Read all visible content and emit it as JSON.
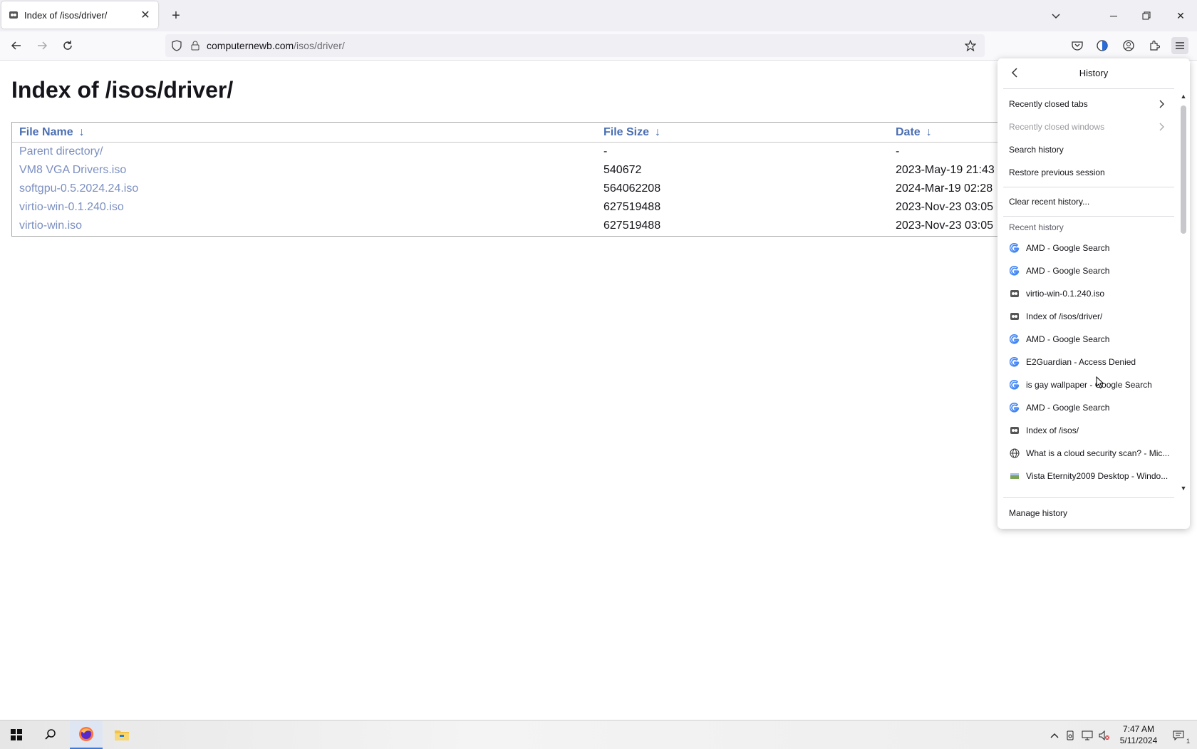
{
  "browser": {
    "tab_title": "Index of /isos/driver/",
    "url_host": "computernewb.com",
    "url_path": "/isos/driver/"
  },
  "page": {
    "title": "Index of /isos/driver/",
    "columns": {
      "name": "File Name",
      "size": "File Size",
      "date": "Date",
      "sort_arrow": "↓"
    },
    "rows": [
      {
        "name": "Parent directory/",
        "size": "-",
        "date": "-"
      },
      {
        "name": "VM8 VGA Drivers.iso",
        "size": "540672",
        "date": "2023-May-19 21:43"
      },
      {
        "name": "softgpu-0.5.2024.24.iso",
        "size": "564062208",
        "date": "2024-Mar-19 02:28"
      },
      {
        "name": "virtio-win-0.1.240.iso",
        "size": "627519488",
        "date": "2023-Nov-23 03:05"
      },
      {
        "name": "virtio-win.iso",
        "size": "627519488",
        "date": "2023-Nov-23 03:05"
      }
    ]
  },
  "history_panel": {
    "title": "History",
    "menu": {
      "recently_closed_tabs": "Recently closed tabs",
      "recently_closed_windows": "Recently closed windows",
      "search_history": "Search history",
      "restore_session": "Restore previous session",
      "clear_history": "Clear recent history...",
      "recent_history_label": "Recent history",
      "manage_history": "Manage history"
    },
    "items": [
      {
        "icon": "google-icon",
        "title": "AMD - Google Search"
      },
      {
        "icon": "google-icon",
        "title": "AMD - Google Search"
      },
      {
        "icon": "site-icon",
        "title": "virtio-win-0.1.240.iso"
      },
      {
        "icon": "site-icon",
        "title": "Index of /isos/driver/"
      },
      {
        "icon": "google-icon",
        "title": "AMD - Google Search"
      },
      {
        "icon": "google-icon",
        "title": "E2Guardian - Access Denied"
      },
      {
        "icon": "google-icon",
        "title": "is gay wallpaper - Google Search"
      },
      {
        "icon": "google-icon",
        "title": "AMD - Google Search"
      },
      {
        "icon": "site-icon",
        "title": "Index of /isos/"
      },
      {
        "icon": "globe-icon",
        "title": "What is a cloud security scan? - Mic..."
      },
      {
        "icon": "image-icon",
        "title": "Vista Eternity2009 Desktop - Windo..."
      }
    ]
  },
  "taskbar": {
    "time": "7:47 AM",
    "date": "5/11/2024",
    "notification_count": "1"
  },
  "colors": {
    "link": "#7b8fc0",
    "header_link": "#4a6fb1",
    "accent": "#3c78d8"
  }
}
